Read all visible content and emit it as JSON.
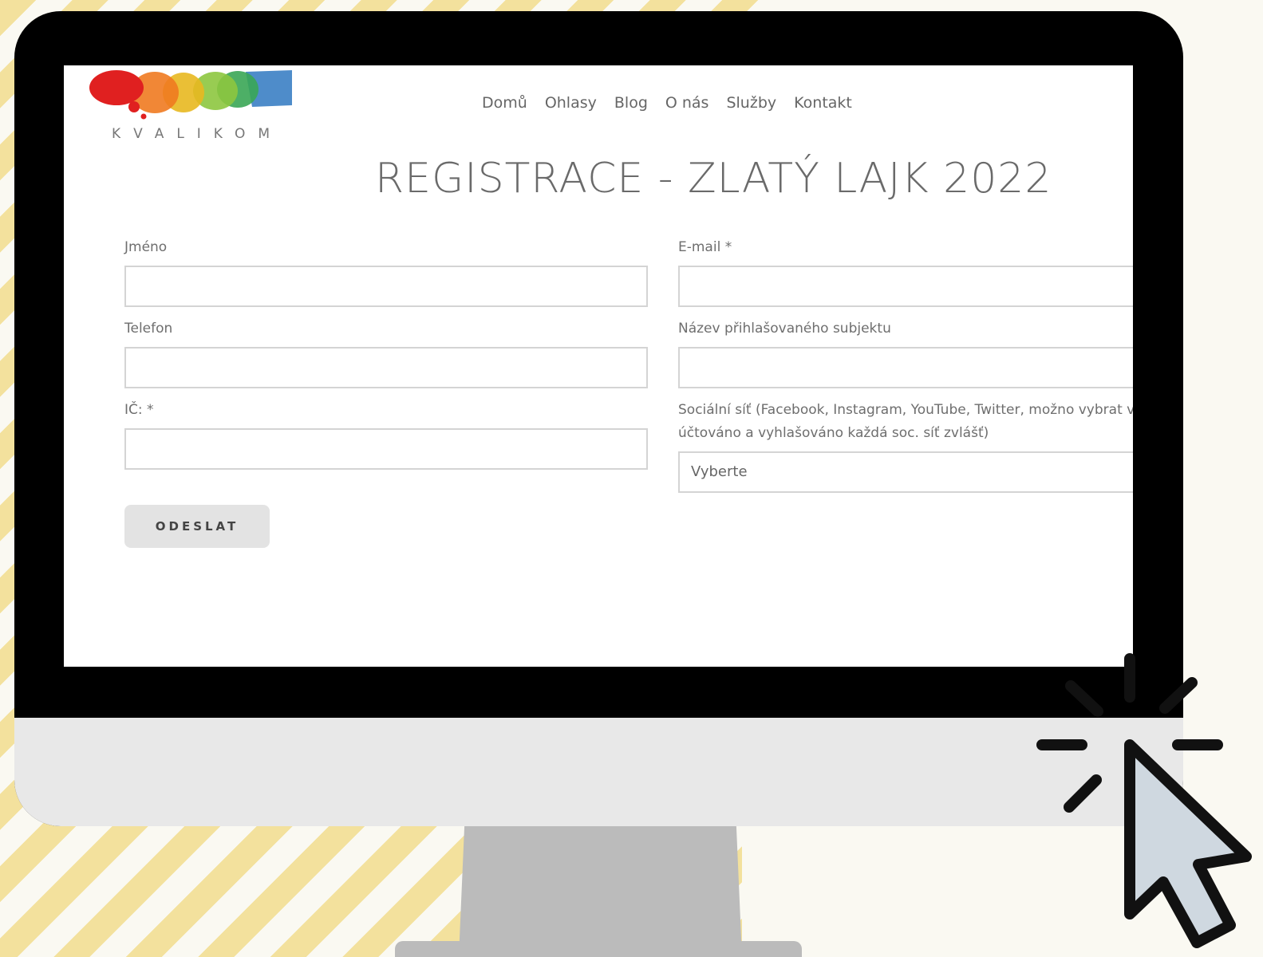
{
  "logo": {
    "text": "KVALIKOM"
  },
  "nav": {
    "items": [
      "Domů",
      "Ohlasy",
      "Blog",
      "O nás",
      "Služby",
      "Kontakt"
    ]
  },
  "page": {
    "title": "REGISTRACE - ZLATÝ LAJK 2022"
  },
  "form": {
    "name_label": "Jméno",
    "email_label": "E-mail *",
    "phone_label": "Telefon",
    "subject_label": "Název přihlašovaného subjektu",
    "ic_label": "IČ: *",
    "social_label_line1": "Sociální síť (Facebook, Instagram, YouTube, Twitter, možno vybrat více",
    "social_label_line2": "účtováno a vyhlašováno každá soc. síť zvlášť)",
    "social_select_value": "Vyberte",
    "submit_label": "ODESLAT"
  },
  "colors": {
    "background_stripe": "#f3e19d",
    "background_base": "#faf9f2",
    "monitor_frame": "#000000",
    "monitor_chin": "#e8e8e8",
    "stand": "#bbbbbb",
    "cursor_fill": "#cfd8e0",
    "logo_bubbles": [
      "#e02020",
      "#f07a20",
      "#e8b820",
      "#8dc63f",
      "#3aa655",
      "#3b7fc4"
    ]
  },
  "icons": {
    "cursor": "mouse-pointer-click-icon"
  }
}
